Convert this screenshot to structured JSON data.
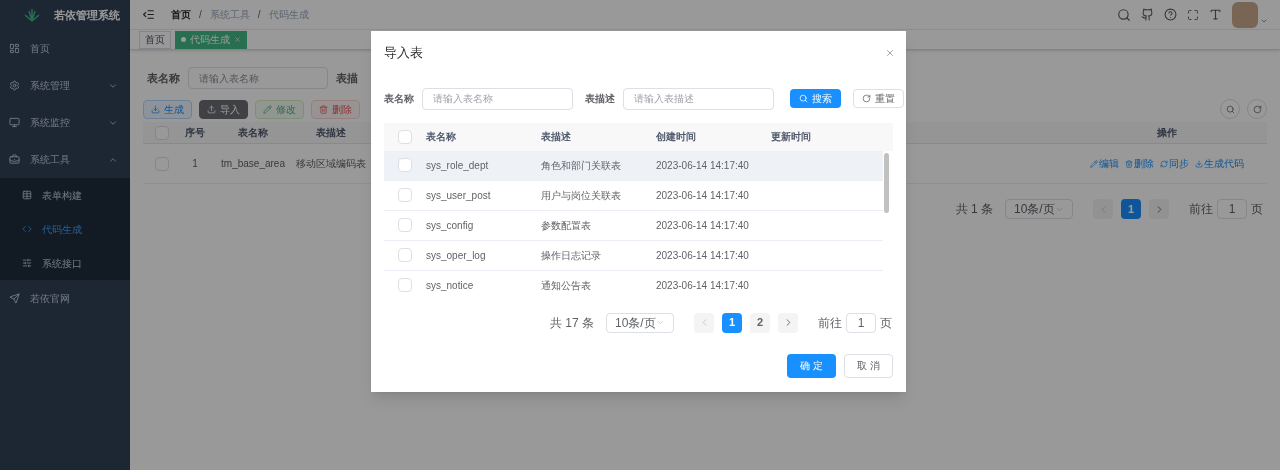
{
  "sidebar": {
    "title": "若依管理系统",
    "items": [
      {
        "label": "首页",
        "kind": "link",
        "selected": false
      },
      {
        "label": "系统管理",
        "kind": "group",
        "expanded": false,
        "selected": false
      },
      {
        "label": "系统监控",
        "kind": "group",
        "expanded": false,
        "selected": false
      },
      {
        "label": "系统工具",
        "kind": "group",
        "expanded": true,
        "selected": false,
        "children": [
          {
            "label": "表单构建",
            "selected": false
          },
          {
            "label": "代码生成",
            "selected": true
          },
          {
            "label": "系统接口",
            "selected": false
          }
        ]
      },
      {
        "label": "若依官网",
        "kind": "link",
        "selected": false
      }
    ]
  },
  "breadcrumbs": [
    "首页",
    "系统工具",
    "代码生成"
  ],
  "breadcrumb_separator": "/",
  "tags": [
    {
      "label": "首页",
      "selected": false
    },
    {
      "label": "代码生成",
      "selected": true
    }
  ],
  "search_form": [
    {
      "label": "表名称",
      "placeholder": "请输入表名称"
    },
    {
      "label": "表描"
    }
  ],
  "toolbar": [
    {
      "label": "生成",
      "kind": "primary",
      "disabled": false
    },
    {
      "label": "导入",
      "kind": "info",
      "disabled": false
    },
    {
      "label": "修改",
      "kind": "success",
      "disabled": true
    },
    {
      "label": "删除",
      "kind": "danger",
      "disabled": true
    }
  ],
  "table": {
    "all_checked": false,
    "columns": [
      "序号",
      "表名称",
      "表描述",
      "操作"
    ],
    "rows": [
      {
        "checked": false,
        "cells": [
          "1",
          "tm_base_area",
          "移动区域编码表"
        ],
        "actions": [
          "编辑",
          "删除",
          "同步",
          "生成代码"
        ]
      }
    ]
  },
  "pagination": {
    "total": "共 1 条",
    "page_size": "10条/页",
    "pages": [
      {
        "label": "1",
        "selected": true
      }
    ],
    "goto": "前往",
    "goto_value": "1",
    "unit": "页"
  },
  "dialog": {
    "title": "导入表",
    "form": [
      {
        "label": "表名称",
        "placeholder": "请输入表名称"
      },
      {
        "label": "表描述",
        "placeholder": "请输入表描述"
      }
    ],
    "search_button": "搜索",
    "reset_button": "重置",
    "all_checked": false,
    "columns": [
      "表名称",
      "表描述",
      "创建时间",
      "更新时间"
    ],
    "rows": [
      {
        "checked": false,
        "highlighted": true,
        "cells": [
          "sys_role_dept",
          "角色和部门关联表",
          "2023-06-14 14:17:40"
        ]
      },
      {
        "checked": false,
        "highlighted": false,
        "cells": [
          "sys_user_post",
          "用户与岗位关联表",
          "2023-06-14 14:17:40"
        ]
      },
      {
        "checked": false,
        "highlighted": false,
        "cells": [
          "sys_config",
          "参数配置表",
          "2023-06-14 14:17:40"
        ]
      },
      {
        "checked": false,
        "highlighted": false,
        "cells": [
          "sys_oper_log",
          "操作日志记录",
          "2023-06-14 14:17:40"
        ]
      },
      {
        "checked": false,
        "highlighted": false,
        "cells": [
          "sys_notice",
          "通知公告表",
          "2023-06-14 14:17:40"
        ]
      }
    ],
    "pagination": {
      "total": "共 17 条",
      "page_size": "10条/页",
      "pages": [
        {
          "label": "1",
          "selected": true
        },
        {
          "label": "2",
          "selected": false
        }
      ],
      "goto": "前往",
      "goto_value": "1",
      "unit": "页"
    },
    "confirm_button": "确 定",
    "cancel_button": "取 消"
  }
}
